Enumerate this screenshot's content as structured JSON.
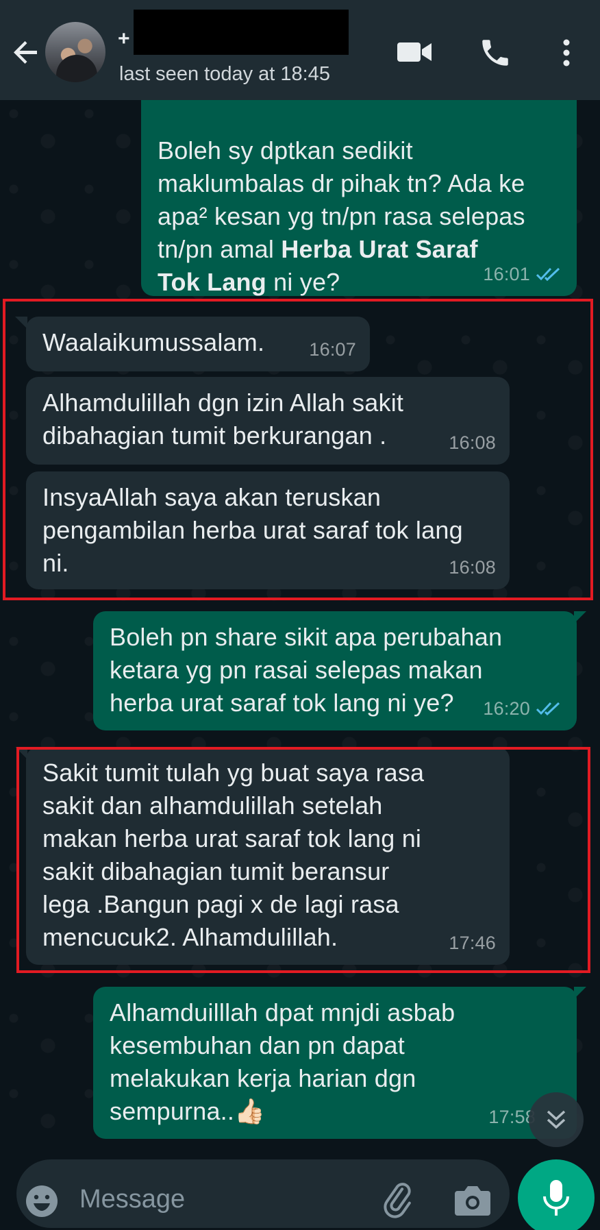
{
  "header": {
    "contact_prefix": "+",
    "last_seen": "last seen today at 18:45"
  },
  "icons": [
    "back-arrow-icon",
    "avatar",
    "video-call-icon",
    "phone-icon",
    "more-vertical-icon",
    "scroll-down-icon",
    "emoji-icon",
    "attachment-icon",
    "camera-icon",
    "mic-icon",
    "double-check-icon"
  ],
  "colors": {
    "header": "#1f2c33",
    "background": "#0b141a",
    "outgoing_bubble": "#005c4b",
    "incoming_bubble": "#1f2c33",
    "highlight_border": "#e21b23",
    "read_ticks": "#53bdeb",
    "mic_button": "#00a884"
  },
  "messages": [
    {
      "direction": "out",
      "text_part1": "Boleh sy dptkan sedikit\nmaklumbalas dr pihak tn? Ada ke\napa² kesan yg tn/pn rasa selepas\ntn/pn amal ",
      "text_bold": "Herba Urat Saraf\nTok Lang",
      "text_part2": " ni ye?",
      "time": "16:01",
      "read": true
    },
    {
      "direction": "in",
      "text": "Waalaikumussalam.",
      "time": "16:07"
    },
    {
      "direction": "in",
      "text": "Alhamdulillah dgn izin Allah sakit\ndibahagian tumit berkurangan .",
      "time": "16:08"
    },
    {
      "direction": "in",
      "text": "InsyaAllah saya akan teruskan\npengambilan herba urat saraf tok lang ni.",
      "time": "16:08"
    },
    {
      "direction": "out",
      "text": "Boleh pn share sikit apa perubahan\nketara yg pn rasai selepas makan\nherba urat saraf tok lang ni ye?",
      "time": "16:20",
      "read": true
    },
    {
      "direction": "in",
      "text": "Sakit tumit tulah yg buat saya rasa\nsakit dan alhamdulillah setelah\nmakan herba urat saraf tok lang ni\nsakit dibahagian tumit beransur\nlega .Bangun pagi x de lagi rasa\nmencucuk2. Alhamdulillah.",
      "time": "17:46"
    },
    {
      "direction": "out",
      "text": "Alhamduilllah dpat mnjdi asbab\nkesembuhan dan pn dapat\nmelakukan kerja harian dgn\nsempurna..👍🏻",
      "time": "17:58"
    }
  ],
  "composer": {
    "placeholder": "Message"
  }
}
